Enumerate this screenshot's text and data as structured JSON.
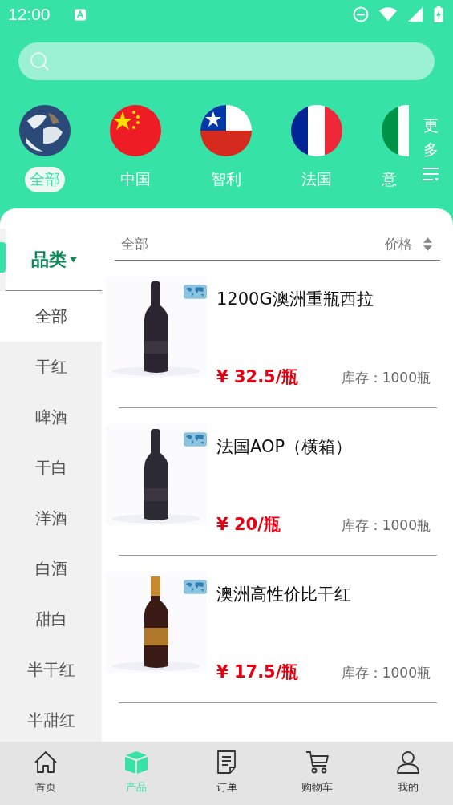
{
  "status_bar": {
    "time": "12:00"
  },
  "countries": [
    {
      "label": "全部",
      "kind": "globe",
      "selected": true
    },
    {
      "label": "中国",
      "kind": "china",
      "selected": false
    },
    {
      "label": "智利",
      "kind": "chile",
      "selected": false
    },
    {
      "label": "法国",
      "kind": "france",
      "selected": false
    },
    {
      "label": "意",
      "kind": "italy",
      "selected": false
    }
  ],
  "more": {
    "label": "更多"
  },
  "sidebar": {
    "header": "品类",
    "items": [
      {
        "label": "全部",
        "selected": true
      },
      {
        "label": "干红",
        "selected": false
      },
      {
        "label": "啤酒",
        "selected": false
      },
      {
        "label": "干白",
        "selected": false
      },
      {
        "label": "洋酒",
        "selected": false
      },
      {
        "label": "白酒",
        "selected": false
      },
      {
        "label": "甜白",
        "selected": false
      },
      {
        "label": "半干红",
        "selected": false
      },
      {
        "label": "半甜红",
        "selected": false
      }
    ]
  },
  "filter": {
    "category": "全部",
    "sort_label": "价格"
  },
  "products": [
    {
      "name": "1200G澳洲重瓶西拉",
      "price": "¥ 32.5/瓶",
      "stock": "库存：1000瓶"
    },
    {
      "name": "法国AOP（横箱）",
      "price": "¥ 20/瓶",
      "stock": "库存：1000瓶"
    },
    {
      "name": "澳洲高性价比干红",
      "price": "¥ 17.5/瓶",
      "stock": "库存：1000瓶"
    }
  ],
  "tabs": [
    {
      "label": "首页",
      "kind": "home",
      "selected": false
    },
    {
      "label": "产品",
      "kind": "products",
      "selected": true
    },
    {
      "label": "订单",
      "kind": "orders",
      "selected": false
    },
    {
      "label": "购物车",
      "kind": "cart",
      "selected": false
    },
    {
      "label": "我的",
      "kind": "profile",
      "selected": false
    }
  ]
}
